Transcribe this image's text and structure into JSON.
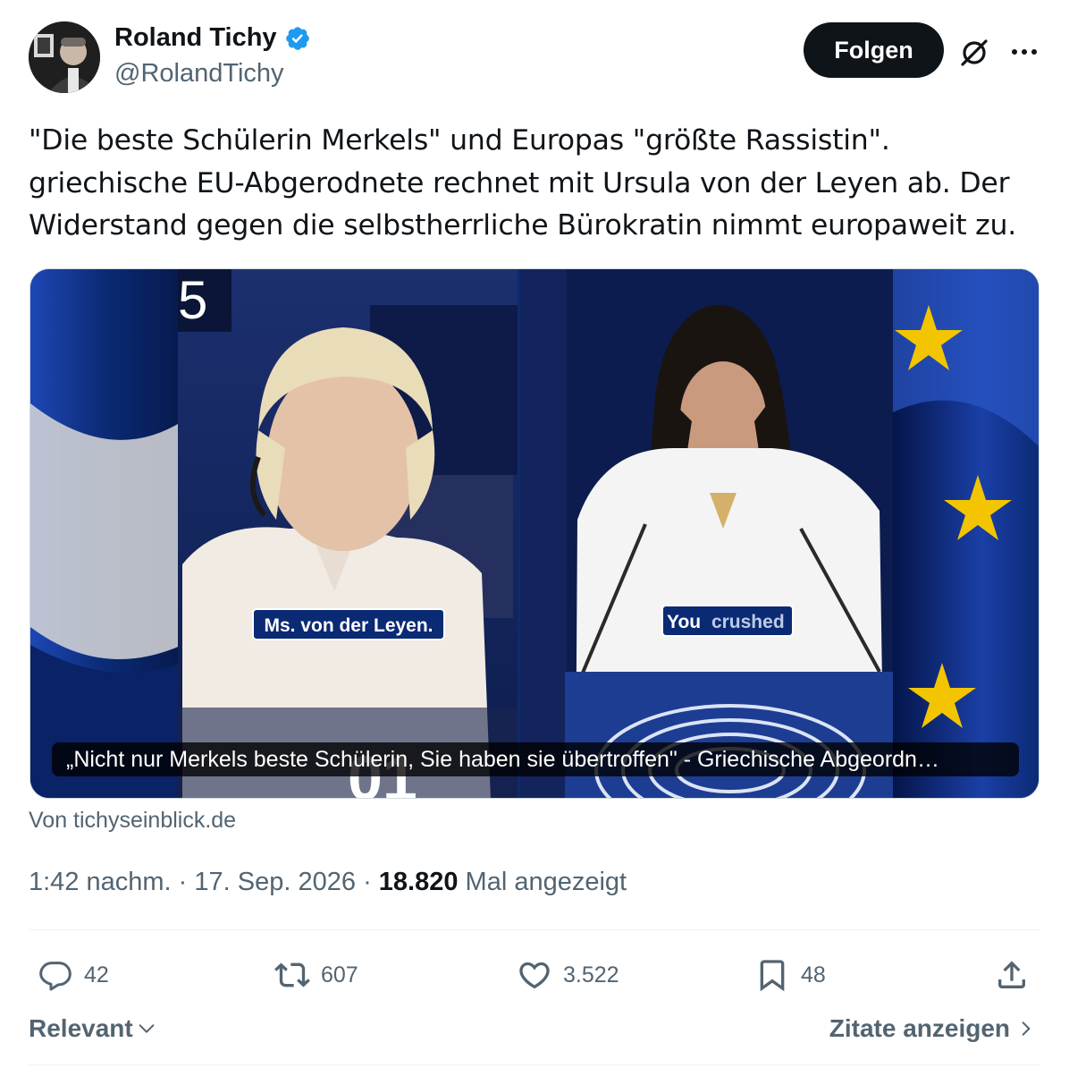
{
  "author": {
    "name": "Roland Tichy",
    "handle": "@RolandTichy",
    "verified": true
  },
  "follow_label": "Folgen",
  "tweet_lines": [
    "\"Die beste Schülerin Merkels\" und Europas \"größte Rassistin\".",
    "griechische EU-Abgerodnete rechnet mit Ursula von der Leyen ab. Der",
    "Widerstand gegen die selbstherrliche Bürokratin nimmt europaweit zu."
  ],
  "media": {
    "subtitle_left": "Ms. von der Leyen.",
    "subtitle_right_a": "You",
    "subtitle_right_b": "crushed",
    "caption": "„Nicht nur Merkels beste Schülerin, Sie haben sie übertroffen\" - Griechische Abgeordn…",
    "source": "Von tichyseinblick.de"
  },
  "meta": {
    "time": "1:42 nachm.",
    "date": "17. Sep. 2026",
    "views_count": "18.820",
    "views_label": "Mal angezeigt"
  },
  "actions": {
    "replies": "42",
    "reposts": "607",
    "likes": "3.522",
    "bookmarks": "48"
  },
  "footer": {
    "sort_label": "Relevant",
    "quotes_label": "Zitate anzeigen"
  },
  "colors": {
    "verified": "#1d9bf0",
    "text_primary": "#0f1419",
    "text_secondary": "#536471",
    "button_bg": "#0f1419",
    "eu_blue": "#0c2a6e",
    "eu_star": "#f2c500"
  }
}
